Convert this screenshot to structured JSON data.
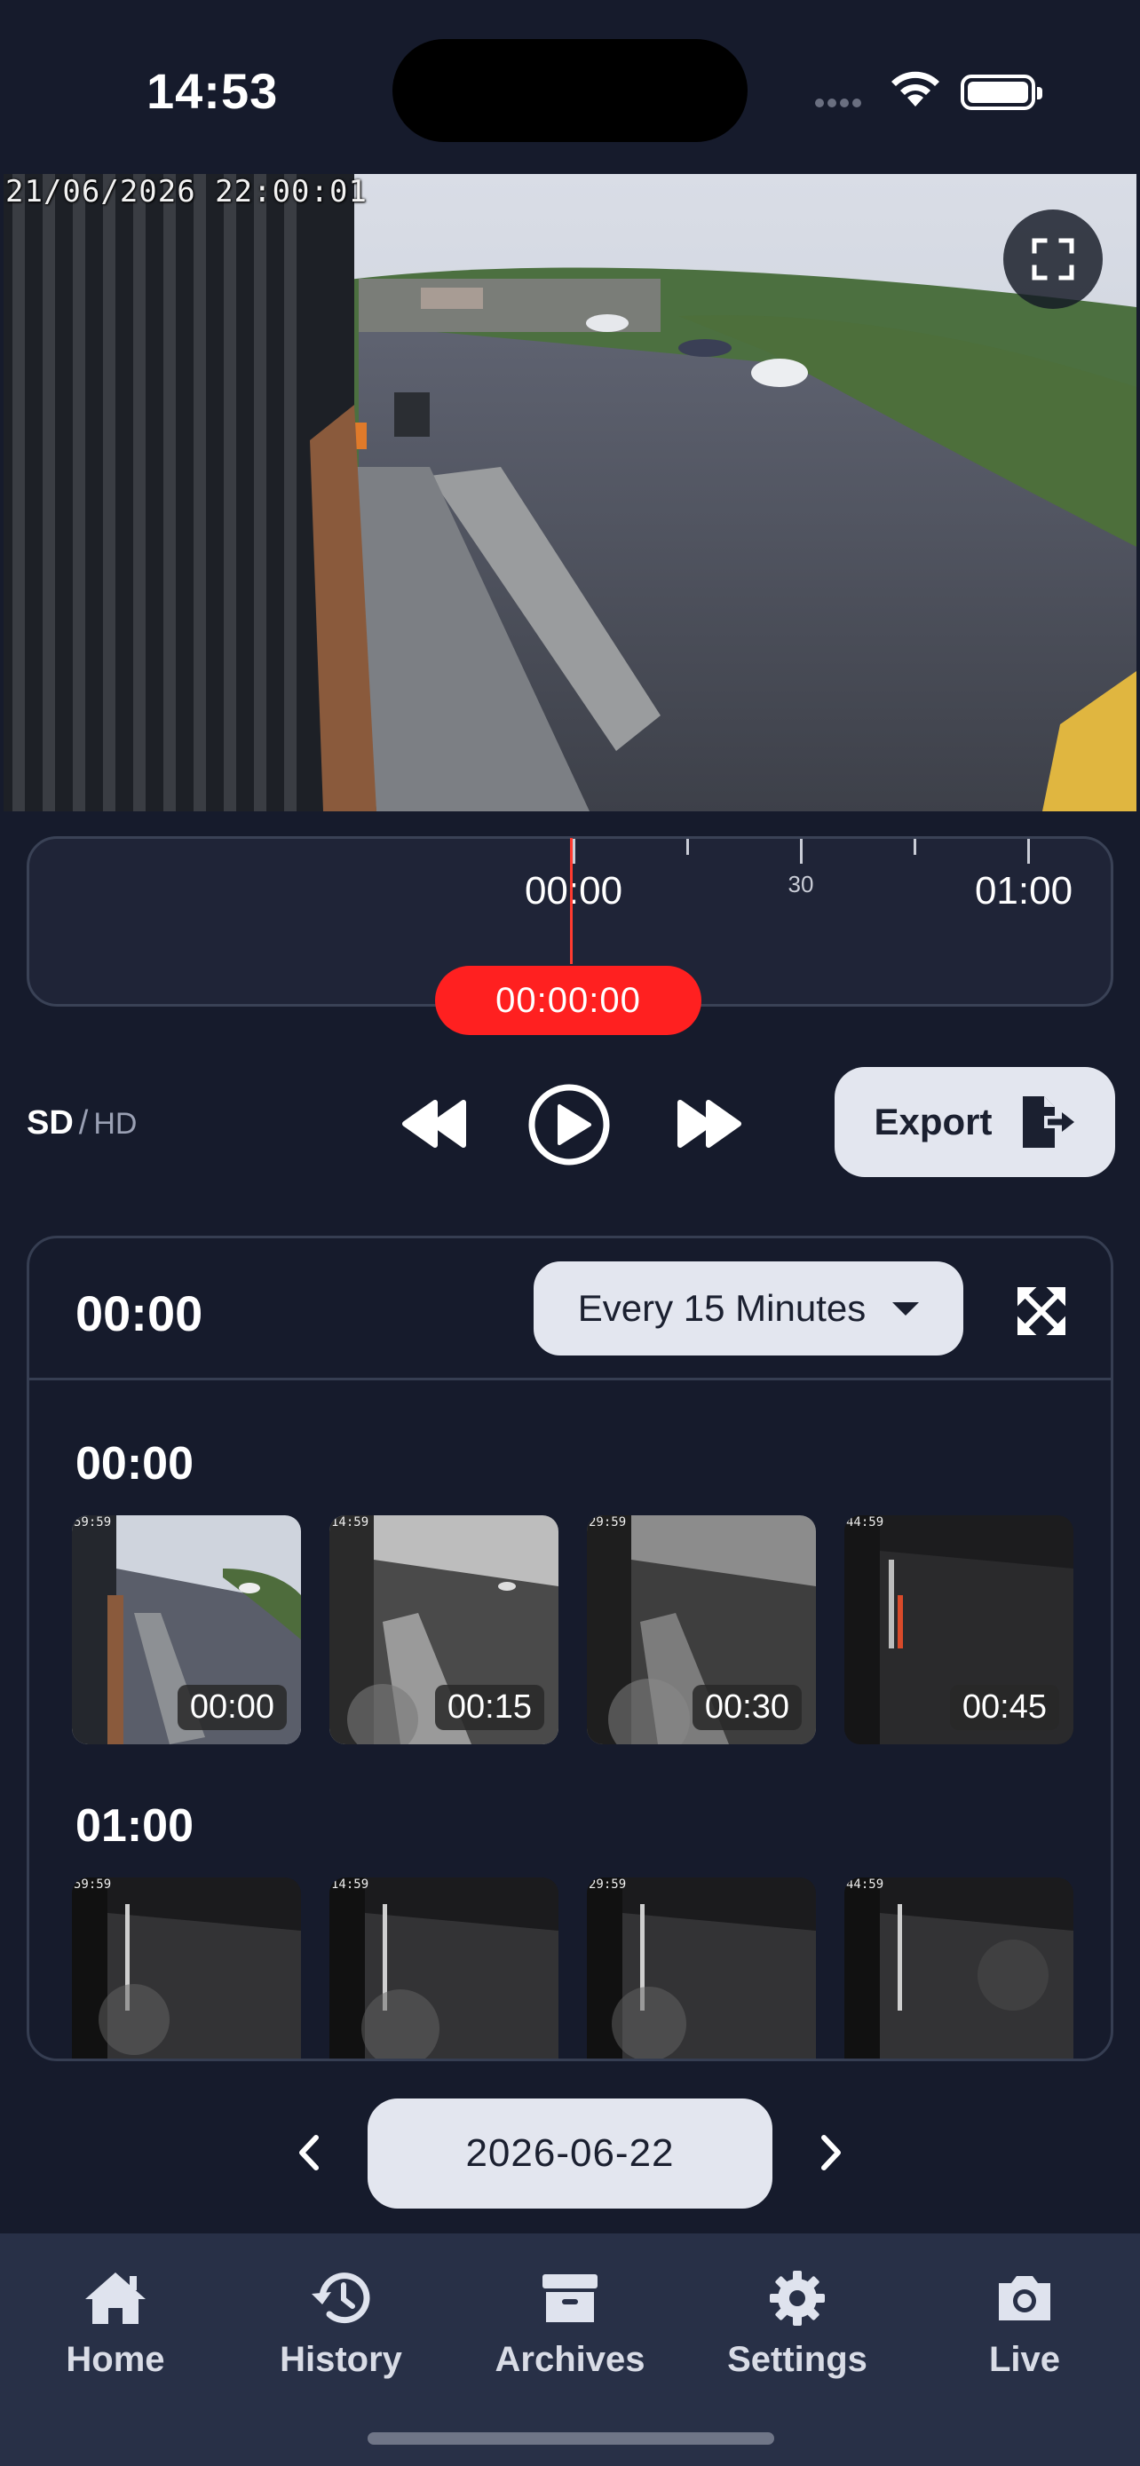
{
  "status_bar": {
    "time": "14:53"
  },
  "player": {
    "overlay_timestamp": "21/06/2026 22:00:01",
    "timeline": {
      "tick_labels": [
        "00:00",
        "30",
        "01:00"
      ],
      "current_time": "00:00:00"
    },
    "quality": {
      "sd": "SD",
      "separator": "/",
      "hd": "HD",
      "selected": "SD"
    },
    "export_label": "Export"
  },
  "snapshots": {
    "header_time": "00:00",
    "interval_label": "Every 15 Minutes",
    "groups": [
      {
        "title": "00:00",
        "thumbs": [
          "00:00",
          "00:15",
          "00:30",
          "00:45"
        ],
        "overlay": [
          "59:59",
          "14:59",
          "29:59",
          "44:59"
        ]
      },
      {
        "title": "01:00",
        "thumbs": [
          "",
          "",
          "",
          ""
        ],
        "overlay": [
          "59:59",
          "14:59",
          "29:59",
          "44:59"
        ]
      }
    ]
  },
  "date_selector": {
    "date": "2026-06-22"
  },
  "tabbar": {
    "items": [
      {
        "label": "Home",
        "icon": "home-icon"
      },
      {
        "label": "History",
        "icon": "history-icon"
      },
      {
        "label": "Archives",
        "icon": "archive-icon"
      },
      {
        "label": "Settings",
        "icon": "gear-icon"
      },
      {
        "label": "Live",
        "icon": "camera-icon"
      }
    ]
  },
  "colors": {
    "background": "#161b2c",
    "accent_red": "#ff2020",
    "pill": "#e3e6ef",
    "tabbar": "#283047"
  }
}
